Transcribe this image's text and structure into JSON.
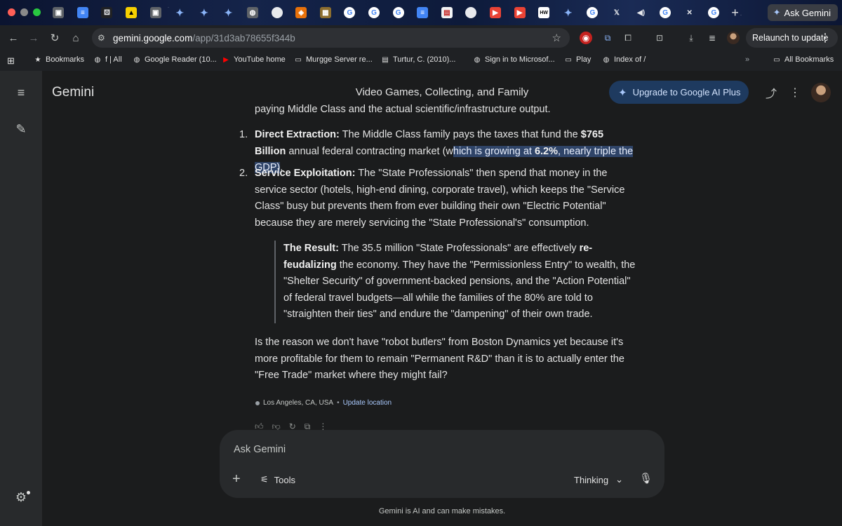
{
  "browser": {
    "tabs": [
      {
        "icon": "notion-icon",
        "color": "#5f6368",
        "glyph": "▣"
      },
      {
        "icon": "google-docs-icon",
        "color": "#4285f4",
        "glyph": "≡"
      },
      {
        "icon": "dice-icon",
        "color": "#202124",
        "glyph": "⚄"
      },
      {
        "icon": "lemon-icon",
        "color": "#f6d000",
        "glyph": "▲"
      },
      {
        "icon": "notion-icon",
        "color": "#5f6368",
        "glyph": "▣"
      },
      {
        "icon": "gemini-icon",
        "color": "transparent",
        "glyph": "✦"
      },
      {
        "icon": "gemini-icon",
        "color": "transparent",
        "glyph": "✦"
      },
      {
        "icon": "gemini-icon",
        "color": "transparent",
        "glyph": "✦"
      },
      {
        "icon": "globe-icon",
        "color": "#5f6368",
        "glyph": "◍"
      },
      {
        "icon": "circle-icon",
        "color": "#e8eaed",
        "glyph": "●"
      },
      {
        "icon": "pizza-icon",
        "color": "#e8710a",
        "glyph": "◈"
      },
      {
        "icon": "book-icon",
        "color": "#8d6e2f",
        "glyph": "▦"
      },
      {
        "icon": "google-icon",
        "color": "#ffffff",
        "glyph": "G"
      },
      {
        "icon": "google-icon",
        "color": "#ffffff",
        "glyph": "G"
      },
      {
        "icon": "google-icon",
        "color": "#ffffff",
        "glyph": "G"
      },
      {
        "icon": "google-docs-icon",
        "color": "#4285f4",
        "glyph": "≡"
      },
      {
        "icon": "pdf-icon",
        "color": "#f1f3f4",
        "glyph": "▤"
      },
      {
        "icon": "circle-icon",
        "color": "#e8eaed",
        "glyph": "●"
      },
      {
        "icon": "youtube-icon",
        "color": "#ea4335",
        "glyph": "▶"
      },
      {
        "icon": "youtube-icon",
        "color": "#ea4335",
        "glyph": "▶"
      },
      {
        "icon": "hw-icon",
        "color": "#ffffff",
        "glyph": "HW"
      },
      {
        "icon": "gemini-icon",
        "color": "transparent",
        "glyph": "✦"
      },
      {
        "icon": "google-icon",
        "color": "#ffffff",
        "glyph": "G"
      },
      {
        "icon": "x-icon",
        "color": "transparent",
        "glyph": "𝕏"
      },
      {
        "icon": "speaker-icon",
        "color": "transparent",
        "glyph": "◀)"
      },
      {
        "icon": "google-icon",
        "color": "#ffffff",
        "glyph": "G"
      },
      {
        "icon": "close-icon",
        "color": "transparent",
        "glyph": "✕"
      },
      {
        "icon": "google-icon",
        "color": "#ffffff",
        "glyph": "G"
      }
    ],
    "ask_gemini": "Ask Gemini",
    "url_host": "gemini.google.com",
    "url_path": "/app/31d3ab78655f344b",
    "relaunch": "Relaunch to update",
    "bookmarks": [
      {
        "label": "Bookmarks",
        "icon": "star-icon",
        "glyph": "★"
      },
      {
        "label": "f | All",
        "icon": "globe-icon",
        "glyph": "◍"
      },
      {
        "label": "Google Reader (10...",
        "icon": "globe-icon",
        "glyph": "◍"
      },
      {
        "label": "YouTube home",
        "icon": "youtube-icon",
        "glyph": "▶"
      },
      {
        "label": "Murgge Server re...",
        "icon": "folder-icon",
        "glyph": "▭"
      },
      {
        "label": "Turtur, C. (2010)...",
        "icon": "pdf-icon",
        "glyph": "▤"
      },
      {
        "label": "Sign in to Microsof...",
        "icon": "globe-icon",
        "glyph": "◍"
      },
      {
        "label": "Play",
        "icon": "folder-icon",
        "glyph": "▭"
      },
      {
        "label": "Index of /",
        "icon": "globe-icon",
        "glyph": "◍"
      }
    ],
    "all_bookmarks": "All Bookmarks"
  },
  "app": {
    "brand": "Gemini",
    "conversation_title": "Video Games, Collecting, and Family",
    "upgrade": "Upgrade to Google AI Plus"
  },
  "response": {
    "cut_line": "paying Middle Class and the actual scientific/infrastructure output.",
    "item1": {
      "num": "1.",
      "label": "Direct Extraction:",
      "t1": " The Middle Class family pays the taxes that fund the ",
      "b1": "$765 Billion",
      "t2": " annual federal contracting market (w",
      "h1": "hich is growing at ",
      "hb": "6.2%",
      "h2": ", nearly triple the GDP)",
      "t3": "."
    },
    "item2": {
      "num": "2.",
      "label": "Service Exploitation:",
      "text": " The \"State Professionals\" then spend that money in the service sector (hotels, high-end dining, corporate travel), which keeps the \"Service Class\" busy but prevents them from ever building their own \"Electric Potential\" because they are merely servicing the \"State Professional's\" consumption."
    },
    "quote": {
      "label": "The Result:",
      "t1": " The 35.5 million \"State Professionals\" are effectively ",
      "b1": "re-feudalizing",
      "t2": " the economy. They have the \"Permissionless Entry\" to wealth, the \"Shelter Security\" of government-backed pensions, and the \"Action Potential\" of federal travel budgets—all while the families of the 80% are told to \"straighten their ties\" and endure the \"dampening\" of their own trade."
    },
    "closing": "Is the reason we don't have \"robot butlers\" from Boston Dynamics yet because it's more profitable for them to remain \"Permanent R&D\" than it is to actually enter the \"Free Trade\" market where they might fail?"
  },
  "location": {
    "place": "Los Angeles, CA, USA",
    "sep": "•",
    "update": "Update location"
  },
  "composer": {
    "placeholder": "Ask Gemini",
    "tools": "Tools",
    "mode": "Thinking"
  },
  "disclaimer": "Gemini is AI and can make mistakes."
}
